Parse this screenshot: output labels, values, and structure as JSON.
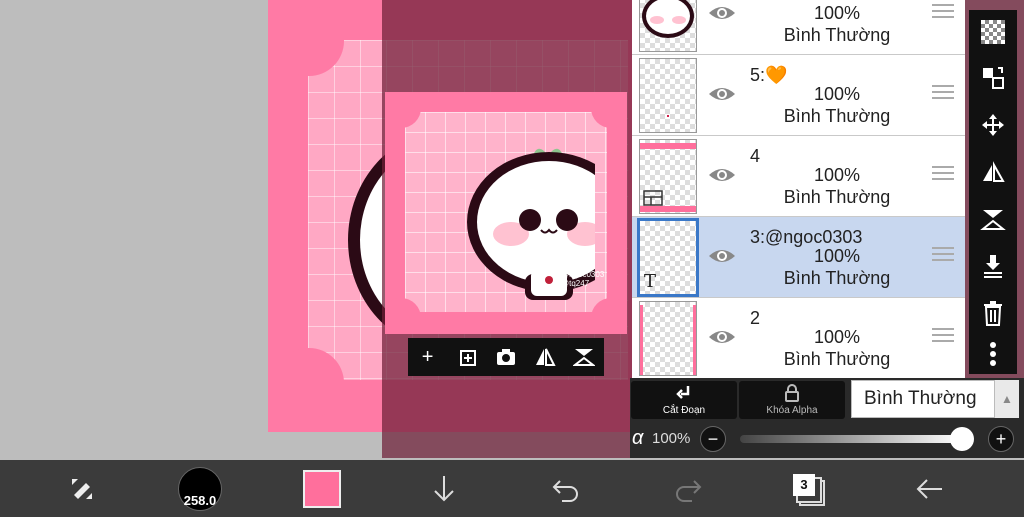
{
  "layers": [
    {
      "name": "",
      "opacity": "100%",
      "mode": "Bình Thường",
      "selected": false
    },
    {
      "name": "5:🧡",
      "opacity": "100%",
      "mode": "Bình Thường",
      "selected": false
    },
    {
      "name": "4",
      "opacity": "100%",
      "mode": "Bình Thường",
      "selected": false
    },
    {
      "name": "3:@ngoc0303",
      "opacity": "100%",
      "mode": "Bình Thường",
      "selected": true
    },
    {
      "name": "2",
      "opacity": "100%",
      "mode": "Bình Thường",
      "selected": false
    }
  ],
  "layer_text_thumb": "T",
  "blend": {
    "clip_label": "Cắt Đoạn",
    "alpha_lock_label": "Khóa Alpha",
    "mode_value": "Bình Thường"
  },
  "opacity": {
    "symbol": "α",
    "value": "100%",
    "fraction": 1.0
  },
  "bottom": {
    "brush_size": "258.0",
    "layer_count": "3"
  },
  "colors": {
    "primary": "#ff6f9c",
    "selected_layer": "#c8d7ef",
    "accent": "#3a78c8"
  },
  "preview": {
    "watermark": "@ngoc0303\n@tq247"
  }
}
